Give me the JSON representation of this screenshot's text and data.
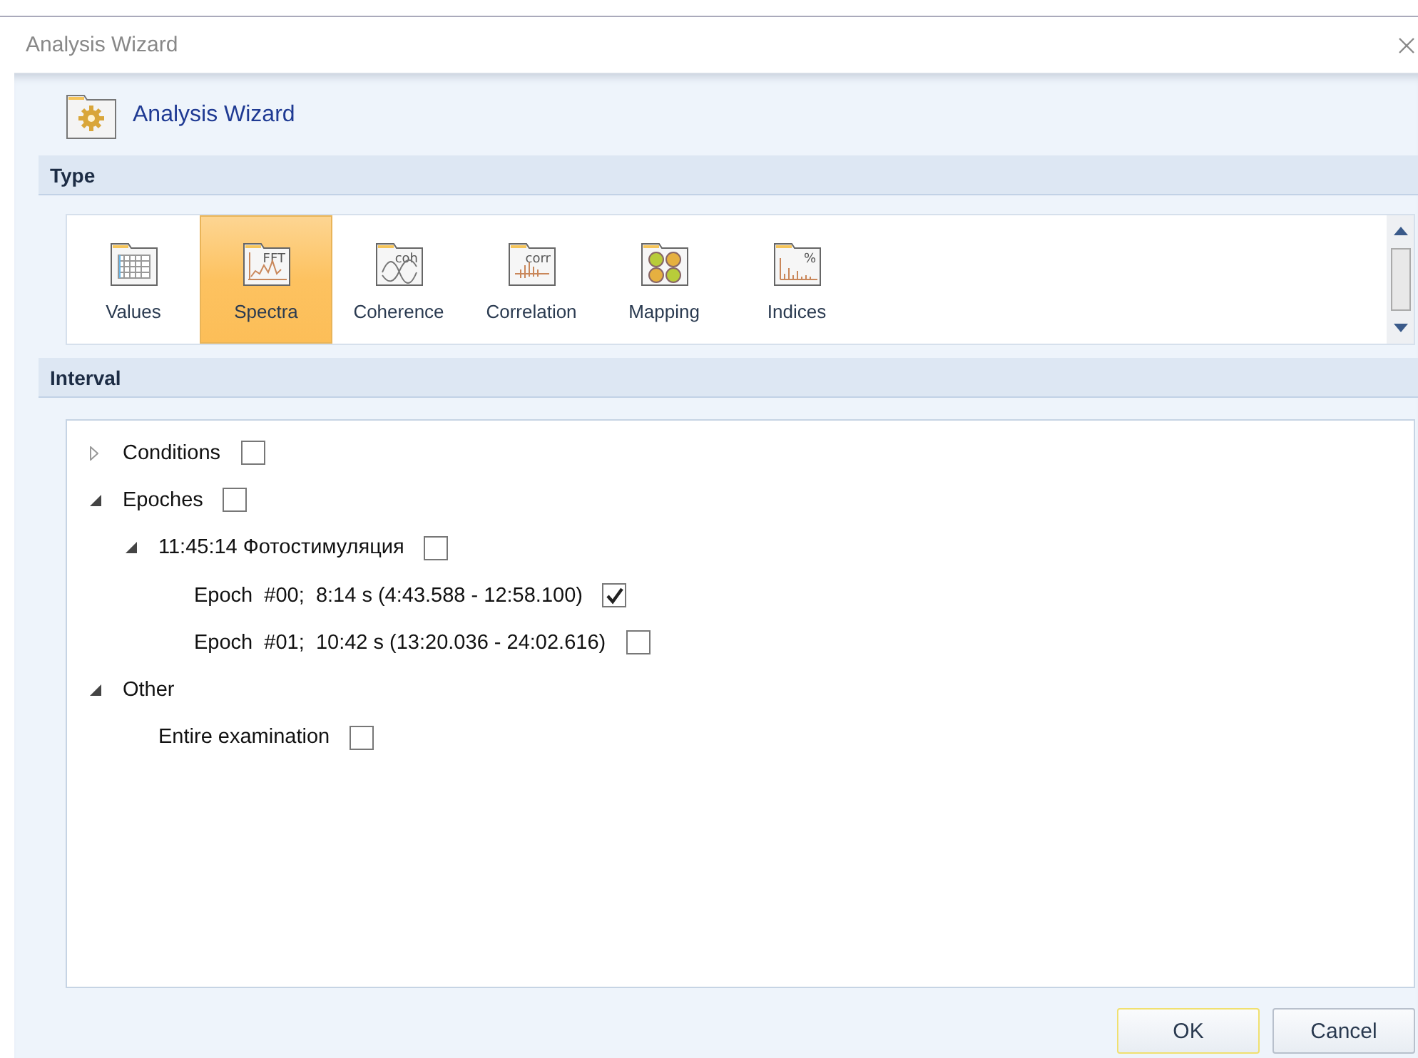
{
  "window": {
    "title": "Analysis Wizard"
  },
  "header": {
    "title": "Analysis Wizard"
  },
  "type_section": {
    "title": "Type",
    "items": [
      {
        "label": "Values",
        "selected": false
      },
      {
        "label": "Spectra",
        "selected": true,
        "icon_text": "FFT"
      },
      {
        "label": "Coherence",
        "selected": false,
        "icon_text": "coh"
      },
      {
        "label": "Correlation",
        "selected": false,
        "icon_text": "corr"
      },
      {
        "label": "Mapping",
        "selected": false
      },
      {
        "label": "Indices",
        "selected": false,
        "icon_text": "%"
      }
    ]
  },
  "interval_section": {
    "title": "Interval",
    "tree": [
      {
        "label": "Conditions",
        "expanded": false,
        "checked": false
      },
      {
        "label": "Epoches",
        "expanded": true,
        "checked": false,
        "children": [
          {
            "label": "11:45:14 Фотостимуляция",
            "expanded": true,
            "checked": false,
            "children": [
              {
                "label": "Epoch  #00;  8:14 s (4:43.588 - 12:58.100)",
                "checked": true
              },
              {
                "label": "Epoch  #01;  10:42 s (13:20.036 - 24:02.616)",
                "checked": false
              }
            ]
          }
        ]
      },
      {
        "label": "Other",
        "expanded": true,
        "children": [
          {
            "label": "Entire examination",
            "checked": false
          }
        ]
      }
    ]
  },
  "buttons": [
    {
      "label": "OK",
      "kind": "default"
    },
    {
      "label": "Cancel",
      "kind": "normal"
    }
  ]
}
